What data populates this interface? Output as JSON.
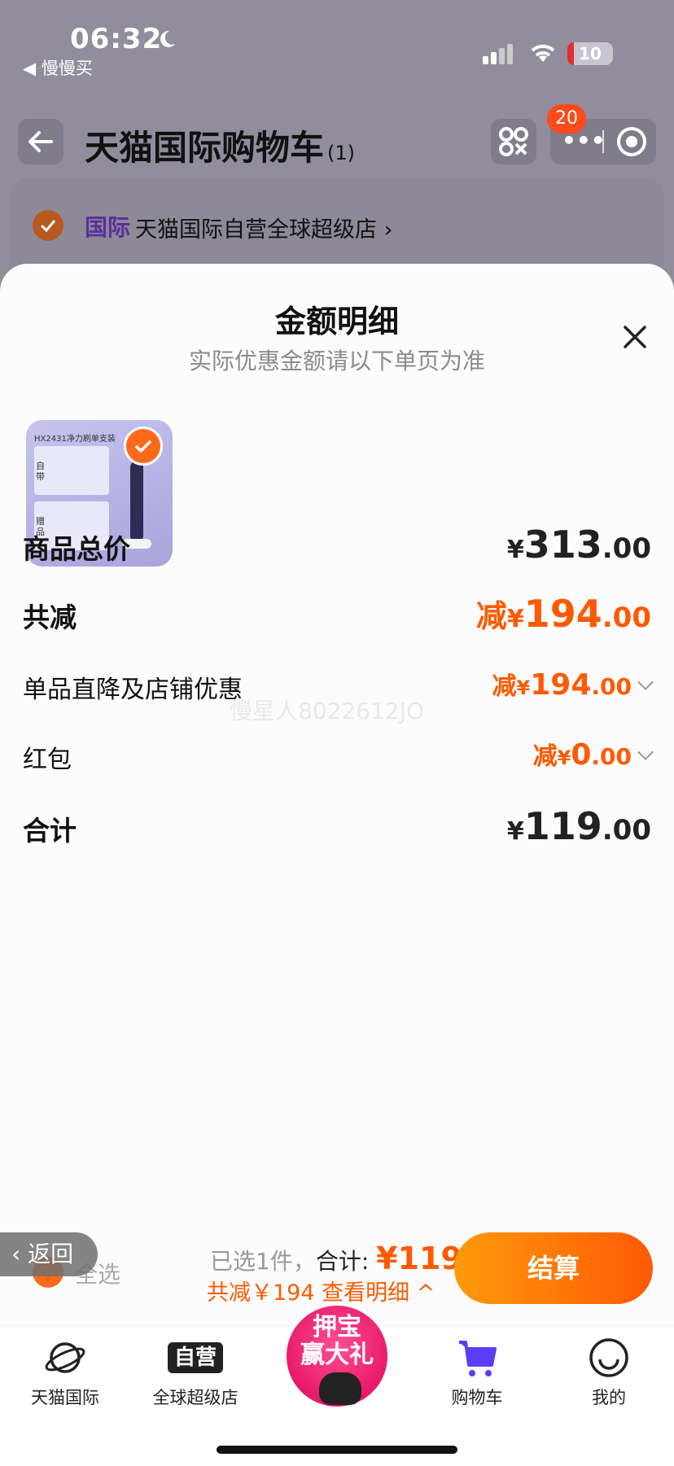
{
  "status_bar": {
    "time": "06:32",
    "back_app": "◀ 慢慢买",
    "battery": "10"
  },
  "header": {
    "title": "天猫国际购物车",
    "count": "(1)",
    "badge": "20"
  },
  "store": {
    "tag": "国际",
    "name": "天猫国际自营全球超级店 ›"
  },
  "sheet": {
    "title": "金额明细",
    "subtitle": "实际优惠金额请以下单页为准",
    "product": {
      "image_title": "HX2431净力刷单支装",
      "image_label_1": "自带",
      "image_label_2": "赠品"
    },
    "rows": {
      "total_price": {
        "label": "商品总价",
        "yen": "¥",
        "int": "313",
        "dec": ".00"
      },
      "total_discount": {
        "label": "共减",
        "prefix": "减",
        "yen": "¥",
        "int": "194",
        "dec": ".00"
      },
      "item_discount": {
        "label": "单品直降及店铺优惠",
        "prefix": "减",
        "yen": "¥",
        "int": "194",
        "dec": ".00"
      },
      "red_packet": {
        "label": "红包",
        "prefix": "减",
        "yen": "¥",
        "int": "0",
        "dec": ".00"
      },
      "sum": {
        "label": "合计",
        "yen": "¥",
        "int": "119",
        "dec": ".00"
      }
    },
    "watermark": "慢星人8022612JO"
  },
  "checkout": {
    "return_label": "‹ 返回",
    "select_all": "全选",
    "selected": "已选1件，",
    "total_label": "合计:",
    "total_amount": "¥119",
    "saved": "共减￥194  查看明细 ^",
    "button": "结算"
  },
  "tabbar": {
    "tab1": "天猫国际",
    "tab2_icon_text": "自营",
    "tab2": "全球超级店",
    "promo_l1": "押宝",
    "promo_l2": "赢大礼",
    "tab4": "购物车",
    "tab5": "我的"
  },
  "colors": {
    "accent": "#ff5a00",
    "overlay": "#918d9c",
    "cart_purple": "#5b3df5"
  }
}
